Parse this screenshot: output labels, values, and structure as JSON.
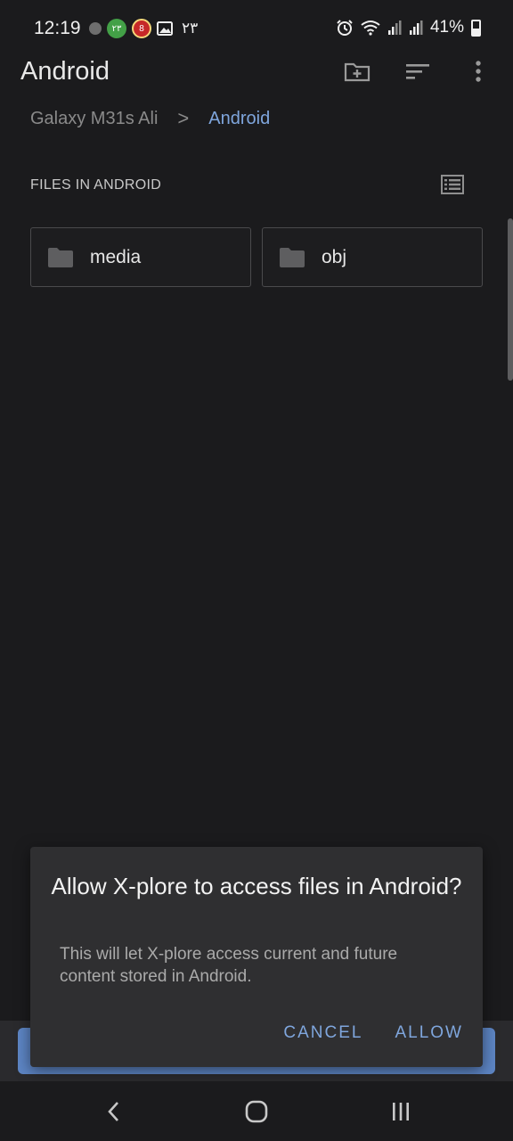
{
  "status_bar": {
    "time": "12:19",
    "badge_green": "۲۳",
    "badge_red": "8",
    "digits": "۲۳",
    "battery": "41%"
  },
  "app_bar": {
    "title": "Android",
    "icons": [
      "new-folder-icon",
      "sort-icon",
      "more-vert-icon"
    ]
  },
  "breadcrumb": {
    "root": "Galaxy M31s Ali",
    "separator": ">",
    "current": "Android"
  },
  "section": {
    "label": "FILES IN ANDROID"
  },
  "folders": [
    {
      "name": "media"
    },
    {
      "name": "obj"
    }
  ],
  "dialog": {
    "title": "Allow X-plore to access files in Android?",
    "body": "This will let X-plore access current and future content stored in Android.",
    "cancel_label": "CANCEL",
    "allow_label": "ALLOW"
  },
  "colors": {
    "accent": "#7fa6dd",
    "background": "#1b1b1d",
    "dialog": "#2f2f31"
  }
}
